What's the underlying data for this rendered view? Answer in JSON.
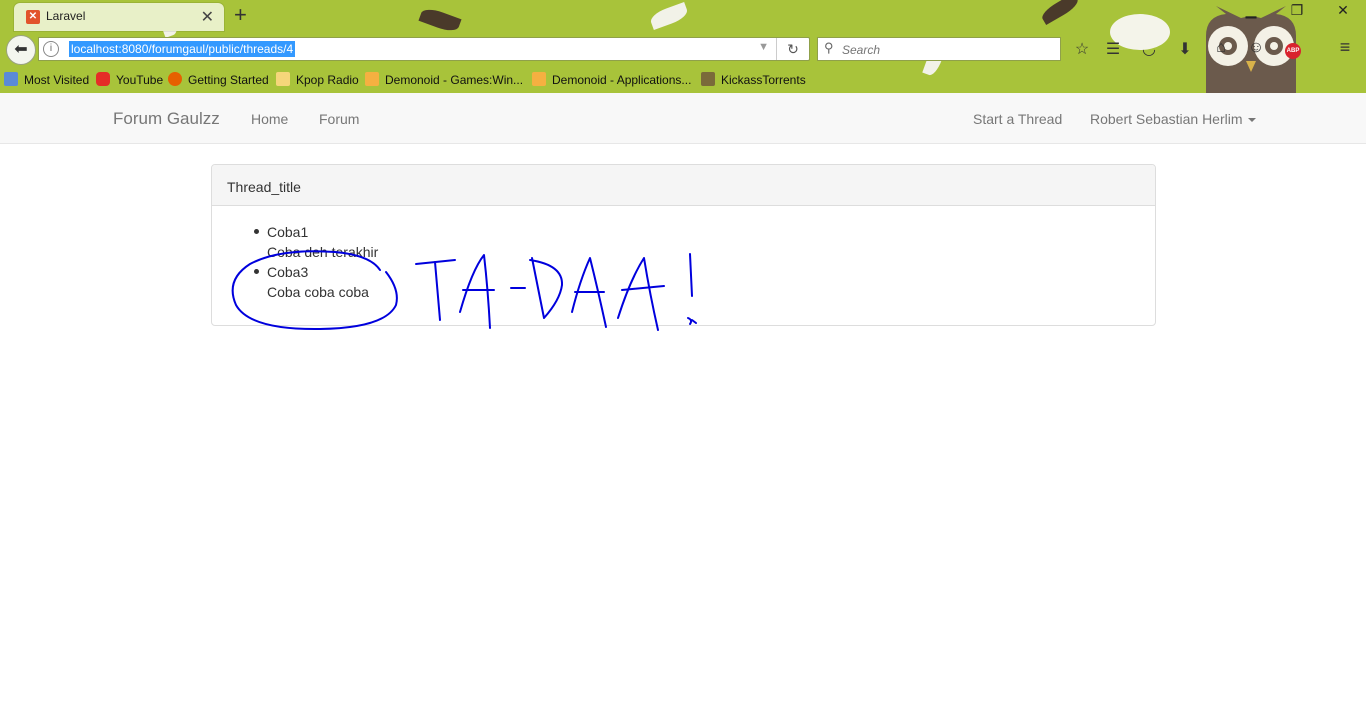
{
  "browser": {
    "tab_title": "Laravel",
    "url": "localhost:8080/forumgaul/public/threads/4",
    "search_placeholder": "Search",
    "bookmarks": [
      "Most Visited",
      "YouTube",
      "Getting Started",
      "Kpop Radio",
      "Demonoid - Games:Win...",
      "Demonoid - Applications...",
      "KickassTorrents"
    ],
    "theme_color": "#a8c33a"
  },
  "site": {
    "brand": "Forum Gaulzz",
    "nav_left": [
      "Home",
      "Forum"
    ],
    "nav_start_thread": "Start a Thread",
    "nav_user": "Robert Sebastian Herlim"
  },
  "thread": {
    "title": "Thread_title",
    "posts": [
      {
        "author": "Coba1",
        "body": "Coba deh terakhir"
      },
      {
        "author": "Coba3",
        "body": "Coba coba coba"
      }
    ]
  },
  "annotation": {
    "ink_color": "#0000dd"
  }
}
